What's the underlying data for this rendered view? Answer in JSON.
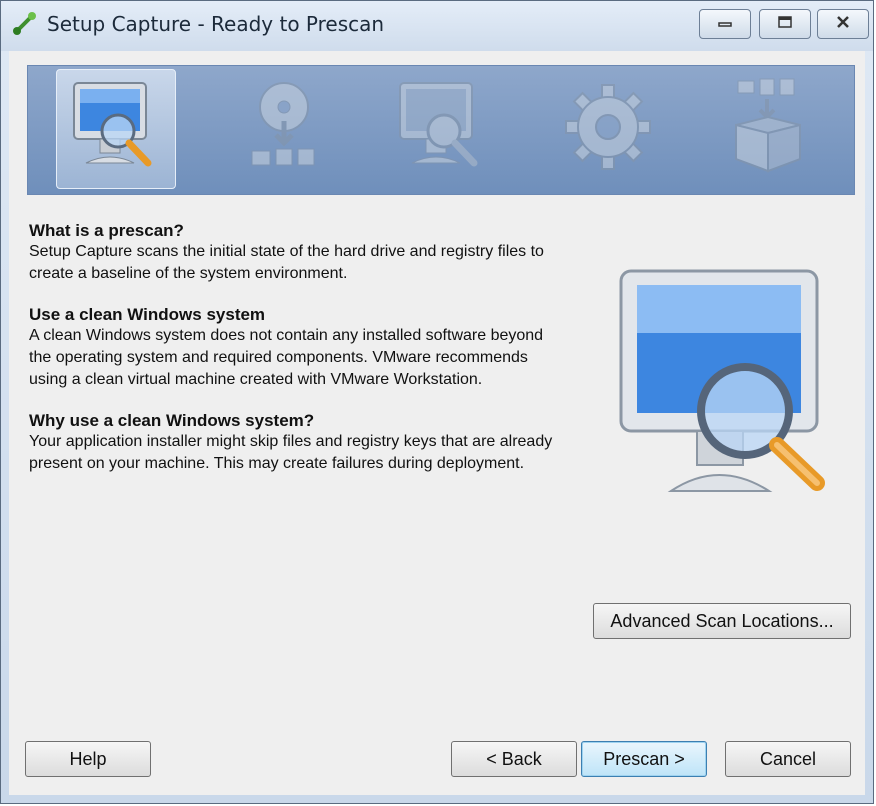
{
  "window": {
    "title": "Setup Capture - Ready to Prescan"
  },
  "wizard_steps": [
    {
      "name": "prescan-step-icon",
      "active": true
    },
    {
      "name": "install-step-icon",
      "active": false
    },
    {
      "name": "postscan-step-icon",
      "active": false
    },
    {
      "name": "configure-step-icon",
      "active": false
    },
    {
      "name": "build-step-icon",
      "active": false
    }
  ],
  "content": {
    "section1_heading": "What is a prescan?",
    "section1_body": "Setup Capture scans the initial state of the hard drive and registry files to create a baseline of the system environment.",
    "section2_heading": "Use a clean Windows system",
    "section2_body": "A clean Windows system does not contain any installed software beyond the operating system and required components. VMware recommends using a clean virtual machine created with VMware Workstation.",
    "section3_heading": "Why use a clean Windows system?",
    "section3_body": "Your application installer might skip files and registry keys that are already present on your machine. This may create failures during deployment."
  },
  "buttons": {
    "advanced_scan_locations": "Advanced Scan Locations...",
    "help": "Help",
    "back": "< Back",
    "prescan": "Prescan >",
    "cancel": "Cancel"
  },
  "colors": {
    "banner": "#7f9bc4",
    "screen_blue": "#4a8ee6",
    "magnifier_handle": "#f0a030"
  }
}
